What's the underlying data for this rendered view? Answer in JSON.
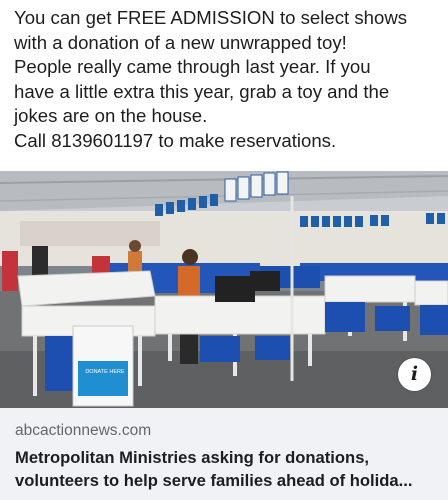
{
  "post": {
    "lines": [
      "You can get FREE ADMISSION to select shows",
      "with a donation of a new unwrapped toy!",
      "People really came through last year. If you",
      "have a little extra this year, grab a toy and the",
      "jokes are on the house.",
      "Call 8139601197 to make reservations."
    ]
  },
  "photo": {
    "info_button": "i",
    "box_label": "DONATE HERE"
  },
  "link": {
    "domain": "abcactionnews.com",
    "title_line1": "Metropolitan Ministries asking for donations,",
    "title_line2": "volunteers to help serve families ahead of holida..."
  }
}
